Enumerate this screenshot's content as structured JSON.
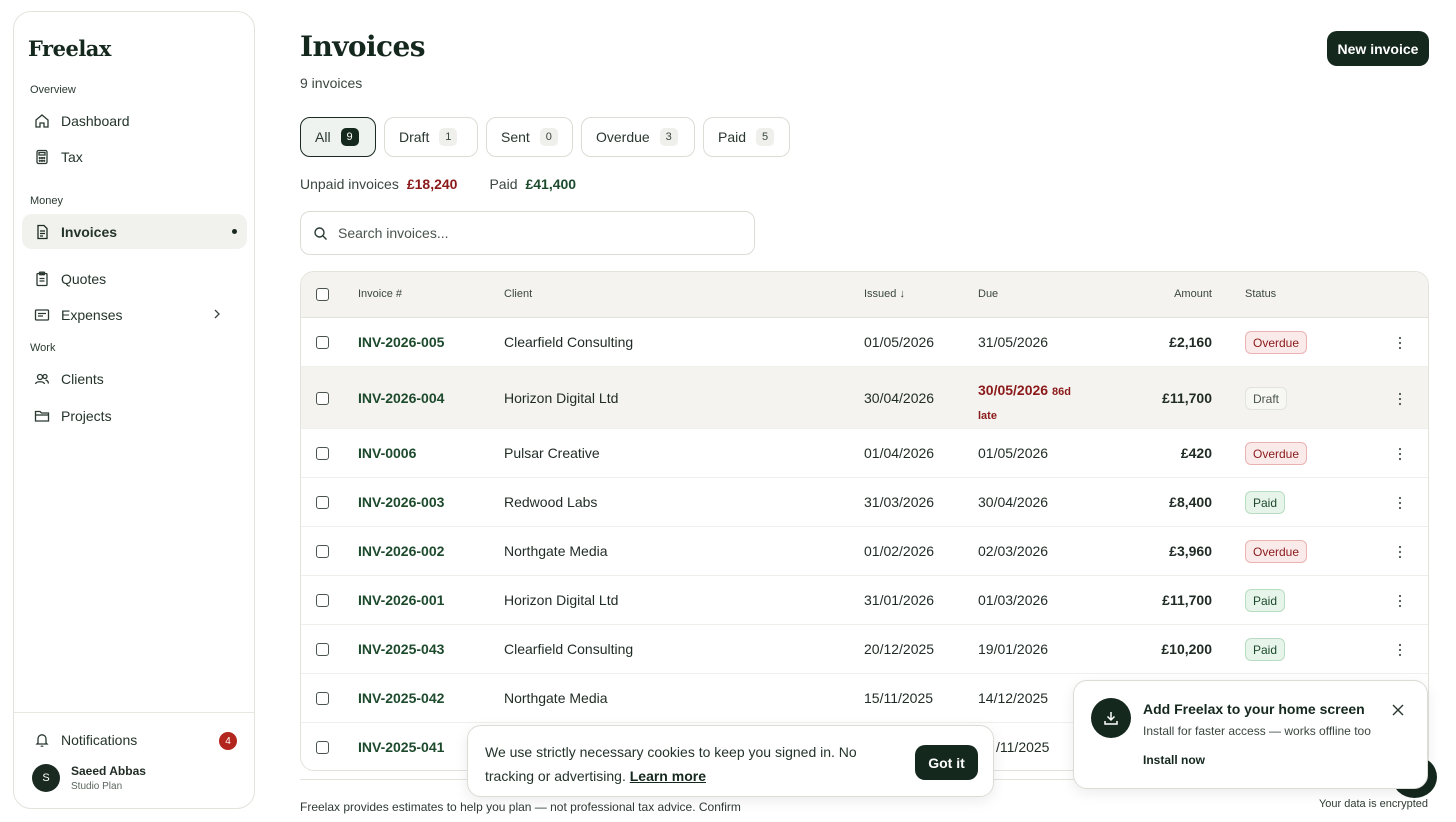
{
  "app": {
    "brand": "Freelax"
  },
  "sidebar": {
    "sections": {
      "overview": "Overview",
      "money": "Money",
      "work": "Work"
    },
    "items": [
      {
        "label": "Dashboard",
        "icon": "home-icon"
      },
      {
        "label": "Tax",
        "icon": "calculator-icon"
      },
      {
        "label": "Invoices",
        "icon": "invoice-icon",
        "active": true
      },
      {
        "label": "Quotes",
        "icon": "clipboard-icon"
      },
      {
        "label": "Expenses",
        "icon": "receipt-icon"
      },
      {
        "label": "Clients",
        "icon": "users-icon"
      },
      {
        "label": "Projects",
        "icon": "folder-icon"
      }
    ],
    "notifications": {
      "label": "Notifications",
      "count": "4"
    },
    "user": {
      "initial": "S",
      "name": "Saeed Abbas",
      "plan": "Studio Plan"
    }
  },
  "header": {
    "title": "Invoices",
    "subtitle": "9 invoices",
    "new_button": "New invoice"
  },
  "filters": [
    {
      "label": "All",
      "count": "9",
      "active": true
    },
    {
      "label": "Draft",
      "count": "1"
    },
    {
      "label": "Sent",
      "count": "0"
    },
    {
      "label": "Overdue",
      "count": "3"
    },
    {
      "label": "Paid",
      "count": "5"
    }
  ],
  "totals": {
    "unpaid_label": "Unpaid invoices",
    "unpaid_value": "£18,240",
    "paid_label": "Paid",
    "paid_value": "£41,400"
  },
  "search": {
    "placeholder": "Search invoices..."
  },
  "table": {
    "columns": {
      "invoice": "Invoice #",
      "client": "Client",
      "issued": "Issued",
      "due": "Due",
      "amount": "Amount",
      "status": "Status"
    },
    "rows": [
      {
        "invoice": "INV-2026-005",
        "client": "Clearfield Consulting",
        "issued": "01/05/2026",
        "due": "31/05/2026",
        "amount": "£2,160",
        "status": "Overdue"
      },
      {
        "invoice": "INV-2026-004",
        "client": "Horizon Digital Ltd",
        "issued": "30/04/2026",
        "due": "30/05/2026",
        "due_late": "86d",
        "due_late2": "late",
        "amount": "£11,700",
        "status": "Draft"
      },
      {
        "invoice": "INV-0006",
        "client": "Pulsar Creative",
        "issued": "01/04/2026",
        "due": "01/05/2026",
        "amount": "£420",
        "status": "Overdue"
      },
      {
        "invoice": "INV-2026-003",
        "client": "Redwood Labs",
        "issued": "31/03/2026",
        "due": "30/04/2026",
        "amount": "£8,400",
        "status": "Paid"
      },
      {
        "invoice": "INV-2026-002",
        "client": "Northgate Media",
        "issued": "01/02/2026",
        "due": "02/03/2026",
        "amount": "£3,960",
        "status": "Overdue"
      },
      {
        "invoice": "INV-2026-001",
        "client": "Horizon Digital Ltd",
        "issued": "31/01/2026",
        "due": "01/03/2026",
        "amount": "£11,700",
        "status": "Paid"
      },
      {
        "invoice": "INV-2025-043",
        "client": "Clearfield Consulting",
        "issued": "20/12/2025",
        "due": "19/01/2026",
        "amount": "£10,200",
        "status": "Paid"
      },
      {
        "invoice": "INV-2025-042",
        "client": "Northgate Media",
        "issued": "15/11/2025",
        "due": "14/12/2025",
        "amount": "",
        "status": ""
      },
      {
        "invoice": "INV-2025-041",
        "client": "",
        "issued": "",
        "due": "/11/2025",
        "amount": "",
        "status": ""
      }
    ]
  },
  "cookie": {
    "text": "We use strictly necessary cookies to keep you signed in. No tracking or advertising.",
    "link": "Learn more",
    "button": "Got it"
  },
  "install": {
    "title": "Add Freelax to your home screen",
    "subtitle": "Install for faster access — works offline too",
    "link": "Install now"
  },
  "footer": {
    "disclaimer": "Freelax provides estimates to help you plan — not professional tax advice. Confirm",
    "encrypted": "Your data is encrypted"
  }
}
